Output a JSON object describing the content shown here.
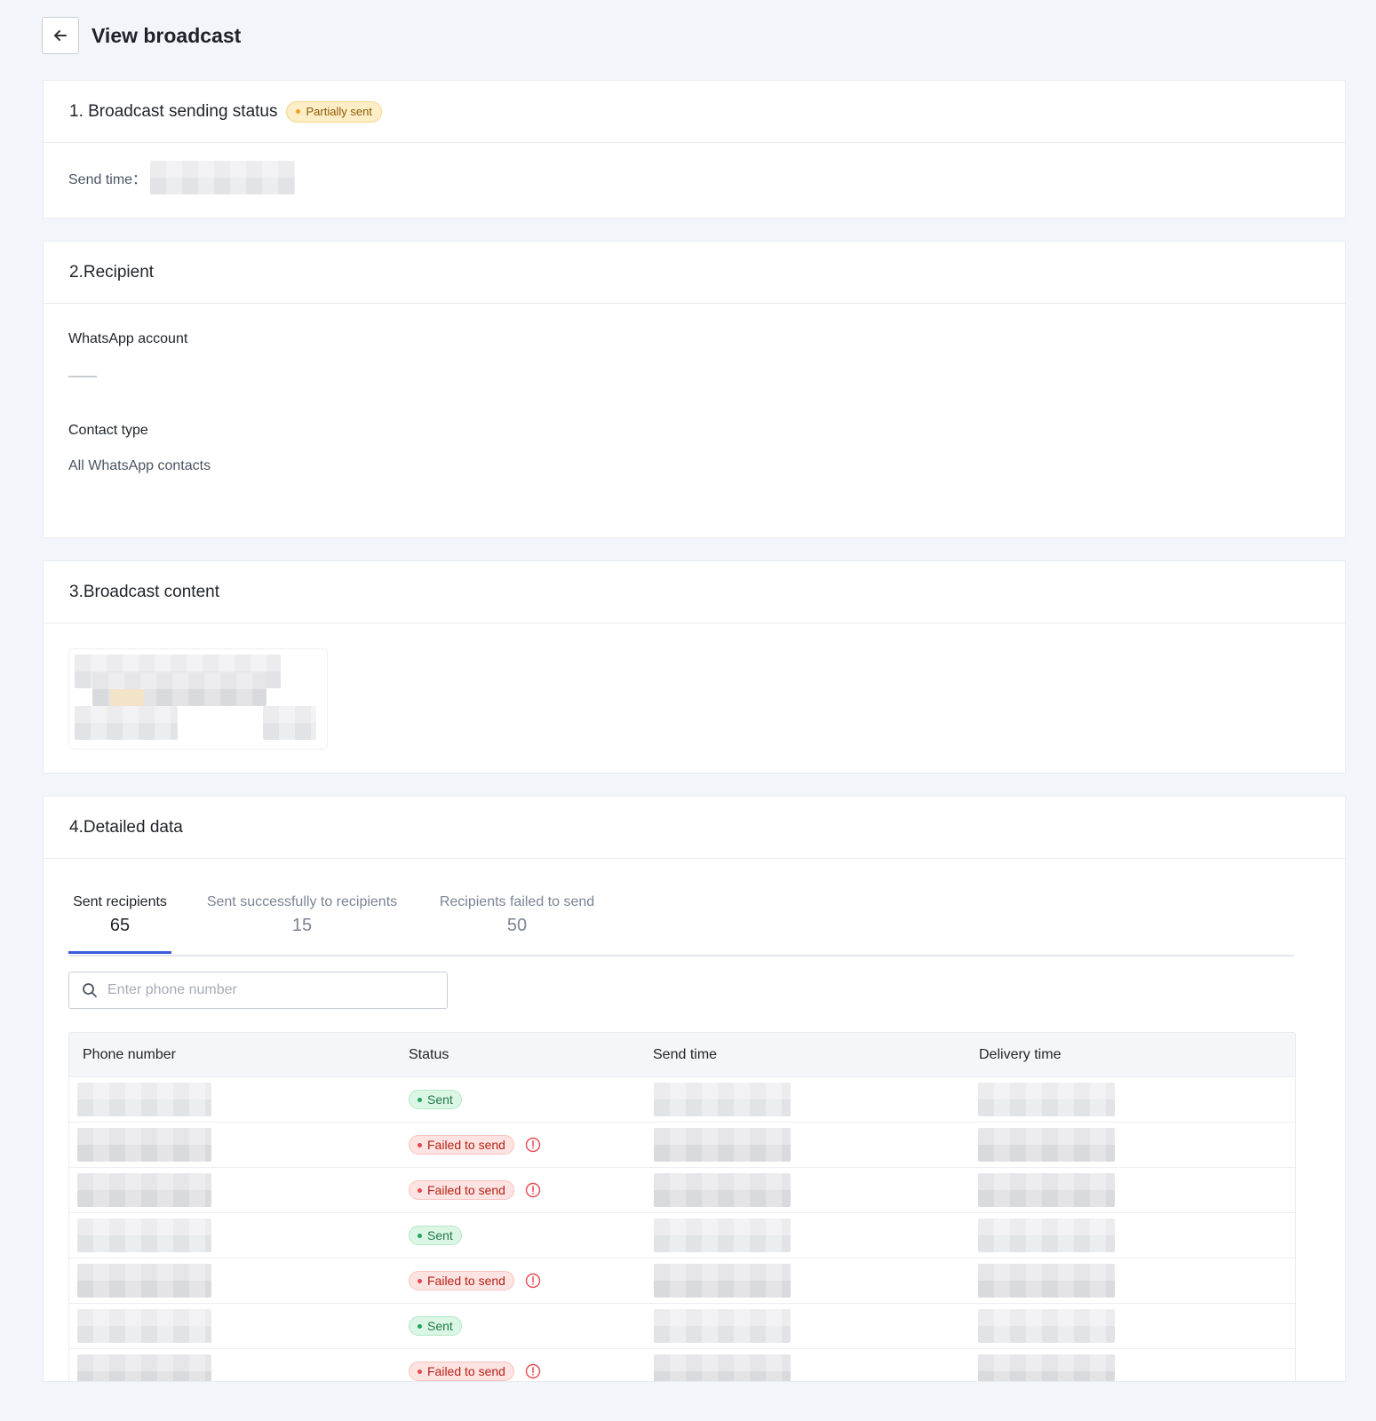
{
  "header": {
    "title": "View broadcast"
  },
  "status_section": {
    "title": "1.  Broadcast sending status",
    "badge": "Partially sent",
    "send_time_label": "Send time："
  },
  "recipient_section": {
    "title": "2.Recipient",
    "account_label": "WhatsApp account",
    "account_value": "——",
    "contact_type_label": "Contact type",
    "contact_type_value": "All WhatsApp contacts"
  },
  "content_section": {
    "title": "3.Broadcast content"
  },
  "detail_section": {
    "title": "4.Detailed data",
    "tabs": [
      {
        "label": "Sent recipients",
        "count": "65"
      },
      {
        "label": "Sent successfully to recipients",
        "count": "15"
      },
      {
        "label": "Recipients failed to send",
        "count": "50"
      }
    ],
    "search_placeholder": "Enter phone number",
    "columns": [
      "Phone number",
      "Status",
      "Send time",
      "Delivery time"
    ],
    "rows": [
      {
        "status": "Sent"
      },
      {
        "status": "Failed to send"
      },
      {
        "status": "Failed to send"
      },
      {
        "status": "Sent"
      },
      {
        "status": "Failed to send"
      },
      {
        "status": "Sent"
      },
      {
        "status": "Failed to send"
      }
    ]
  },
  "colors": {
    "accent": "#3b5bdb",
    "badge_warning": "#fdeec8",
    "status_sent": "#dcf6e6",
    "status_failed": "#fde3e1",
    "failed_icon": "#e5484d"
  },
  "icons": {
    "back": "arrow-left-icon",
    "search": "search-icon",
    "info": "info-circle-icon"
  }
}
